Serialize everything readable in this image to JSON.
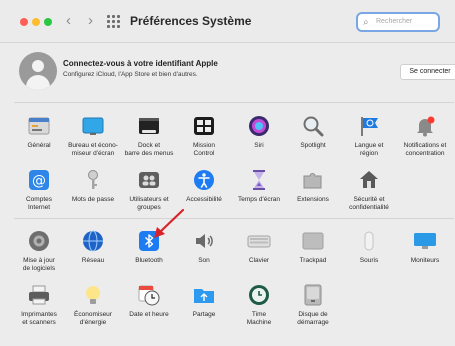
{
  "window": {
    "title": "Préférences Système"
  },
  "nav": {
    "back": "‹",
    "forward": "›"
  },
  "search": {
    "placeholder": "Rechercher",
    "icon": "magnifier-icon"
  },
  "account": {
    "title": "Connectez-vous à votre identifiant Apple",
    "subtitle": "Configurez iCloud, l'App Store et bien d'autres.",
    "button": "Se connecter"
  },
  "colors": {
    "close": "#fe5f57",
    "minimize": "#febc2e",
    "zoom": "#28c840",
    "accent": "#1e7cf2",
    "arrow": "#d8232a"
  },
  "section1": [
    {
      "id": "general",
      "label": "Général",
      "icon": "general-icon"
    },
    {
      "id": "bureau",
      "label": "Bureau et écono-\nmiseur d'écran",
      "icon": "desktop-icon"
    },
    {
      "id": "dock",
      "label": "Dock et\nbarre des menus",
      "icon": "dock-icon"
    },
    {
      "id": "mission",
      "label": "Mission\nControl",
      "icon": "mission-control-icon"
    },
    {
      "id": "siri",
      "label": "Siri",
      "icon": "siri-icon"
    },
    {
      "id": "spotlight",
      "label": "Spotlight",
      "icon": "spotlight-icon"
    },
    {
      "id": "langue",
      "label": "Langue et\nrégion",
      "icon": "flag-icon"
    },
    {
      "id": "notifications",
      "label": "Notifications et\nconcentration",
      "icon": "bell-icon"
    },
    {
      "id": "comptes",
      "label": "Comptes\nInternet",
      "icon": "at-icon"
    },
    {
      "id": "motdepasse",
      "label": "Mots de passe",
      "icon": "key-icon"
    },
    {
      "id": "utilisateurs",
      "label": "Utilisateurs et\ngroupes",
      "icon": "users-icon"
    },
    {
      "id": "accessibilite",
      "label": "Accessibilité",
      "icon": "accessibility-icon"
    },
    {
      "id": "tempsecran",
      "label": "Temps d'écran",
      "icon": "hourglass-icon"
    },
    {
      "id": "extensions",
      "label": "Extensions",
      "icon": "puzzle-icon"
    },
    {
      "id": "securite",
      "label": "Sécurité et\nconfidentialité",
      "icon": "house-icon"
    }
  ],
  "section2": [
    {
      "id": "maj",
      "label": "Mise à jour\nde logiciels",
      "icon": "gear-icon"
    },
    {
      "id": "reseau",
      "label": "Réseau",
      "icon": "globe-icon"
    },
    {
      "id": "bluetooth",
      "label": "Bluetooth",
      "icon": "bluetooth-icon"
    },
    {
      "id": "son",
      "label": "Son",
      "icon": "speaker-icon"
    },
    {
      "id": "clavier",
      "label": "Clavier",
      "icon": "keyboard-icon"
    },
    {
      "id": "trackpad",
      "label": "Trackpad",
      "icon": "trackpad-icon"
    },
    {
      "id": "souris",
      "label": "Souris",
      "icon": "mouse-icon"
    },
    {
      "id": "moniteurs",
      "label": "Moniteurs",
      "icon": "display-icon"
    },
    {
      "id": "imprimantes",
      "label": "Imprimantes\net scanners",
      "icon": "printer-icon"
    },
    {
      "id": "energie",
      "label": "Économiseur\nd'énergie",
      "icon": "bulb-icon"
    },
    {
      "id": "dateheure",
      "label": "Date et heure",
      "icon": "calendar-clock-icon"
    },
    {
      "id": "partage",
      "label": "Partage",
      "icon": "folder-icon"
    },
    {
      "id": "timemachine",
      "label": "Time\nMachine",
      "icon": "time-machine-icon"
    },
    {
      "id": "disque",
      "label": "Disque de\ndémarrage",
      "icon": "disk-icon"
    }
  ]
}
